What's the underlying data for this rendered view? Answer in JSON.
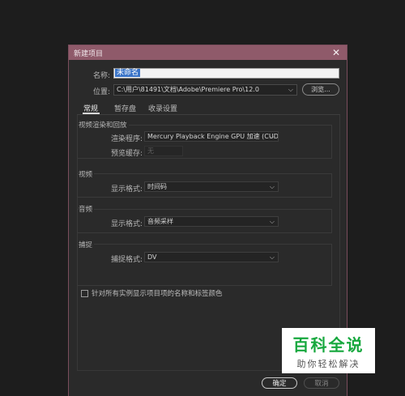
{
  "dialog": {
    "title": "新建项目",
    "close_glyph": "✕"
  },
  "name": {
    "label": "名称:",
    "value": "未命名"
  },
  "location": {
    "label": "位置:",
    "value": "C:\\用户\\81491\\文档\\Adobe\\Premiere Pro\\12.0",
    "browse_label": "浏览..."
  },
  "tabs": [
    {
      "label": "常规",
      "active": true
    },
    {
      "label": "暂存盘",
      "active": false
    },
    {
      "label": "收录设置",
      "active": false
    }
  ],
  "video_render": {
    "title": "视频渲染和回放",
    "renderer_label": "渲染程序:",
    "renderer_value": "Mercury Playback Engine GPU 加速 (CUDA)",
    "preview_cache_label": "预览缓存:",
    "preview_cache_value": "无"
  },
  "video": {
    "title": "视频",
    "format_label": "显示格式:",
    "format_value": "时间码"
  },
  "audio": {
    "title": "音频",
    "format_label": "显示格式:",
    "format_value": "音频采样"
  },
  "capture": {
    "title": "捕捉",
    "format_label": "捕捉格式:",
    "format_value": "DV"
  },
  "checkbox": {
    "label": "针对所有实例显示项目项的名称和标签颜色",
    "checked": false
  },
  "buttons": {
    "ok": "确定",
    "cancel": "取消"
  },
  "watermark": {
    "title": "百科全说",
    "subtitle": "助你轻松解决"
  },
  "colors": {
    "titlebar": "#8f5a6a",
    "dialog_bg": "#2a2a2a",
    "page_bg": "#1d1d1d",
    "selection": "#3a74c8",
    "watermark_green": "#17a83e"
  },
  "icons": [
    "close-icon",
    "chevron-down-icon"
  ]
}
